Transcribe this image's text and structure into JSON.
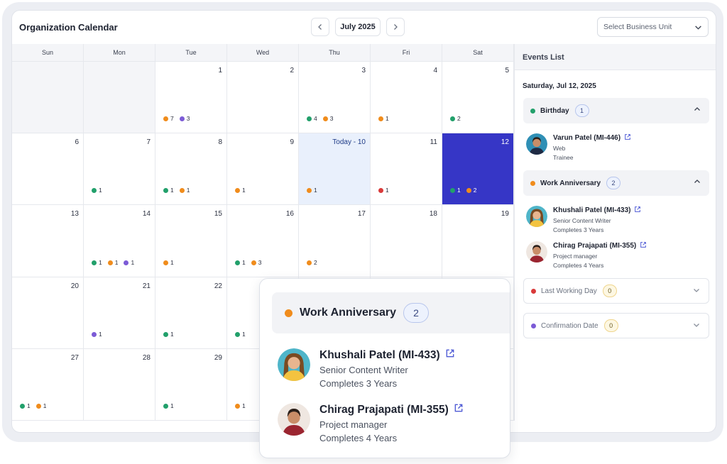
{
  "header": {
    "title": "Organization Calendar",
    "month": "July 2025",
    "prev_icon": "chevron-left-icon",
    "next_icon": "chevron-right-icon",
    "business_unit_placeholder": "Select Business Unit"
  },
  "colors": {
    "green": "#22a06b",
    "orange": "#f08c1c",
    "purple": "#7c5bd6",
    "red": "#d93a3a",
    "selected": "#3636c6",
    "today": "#e9f0fc"
  },
  "weekdays": [
    "Sun",
    "Mon",
    "Tue",
    "Wed",
    "Thu",
    "Fri",
    "Sat"
  ],
  "calendar": {
    "weeks": [
      [
        {
          "day": "",
          "events": []
        },
        {
          "day": "",
          "events": []
        },
        {
          "day": "1",
          "events": [
            {
              "color": "orange",
              "count": "7"
            },
            {
              "color": "purple",
              "count": "3"
            }
          ]
        },
        {
          "day": "2",
          "events": []
        },
        {
          "day": "3",
          "events": [
            {
              "color": "green",
              "count": "4"
            },
            {
              "color": "orange",
              "count": "3"
            }
          ]
        },
        {
          "day": "4",
          "events": [
            {
              "color": "orange",
              "count": "1"
            }
          ]
        },
        {
          "day": "5",
          "events": [
            {
              "color": "green",
              "count": "2"
            }
          ]
        }
      ],
      [
        {
          "day": "6",
          "events": []
        },
        {
          "day": "7",
          "events": [
            {
              "color": "green",
              "count": "1"
            }
          ]
        },
        {
          "day": "8",
          "events": [
            {
              "color": "green",
              "count": "1"
            },
            {
              "color": "orange",
              "count": "1"
            }
          ]
        },
        {
          "day": "9",
          "events": [
            {
              "color": "orange",
              "count": "1"
            }
          ]
        },
        {
          "day": "Today - 10",
          "today": true,
          "events": [
            {
              "color": "orange",
              "count": "1"
            }
          ]
        },
        {
          "day": "11",
          "events": [
            {
              "color": "red",
              "count": "1"
            }
          ]
        },
        {
          "day": "12",
          "selected": true,
          "events": [
            {
              "color": "green",
              "count": "1"
            },
            {
              "color": "orange",
              "count": "2"
            }
          ]
        }
      ],
      [
        {
          "day": "13",
          "events": []
        },
        {
          "day": "14",
          "events": [
            {
              "color": "green",
              "count": "1"
            },
            {
              "color": "orange",
              "count": "1"
            },
            {
              "color": "purple",
              "count": "1"
            }
          ]
        },
        {
          "day": "15",
          "events": [
            {
              "color": "orange",
              "count": "1"
            }
          ]
        },
        {
          "day": "16",
          "events": [
            {
              "color": "green",
              "count": "1"
            },
            {
              "color": "orange",
              "count": "3"
            }
          ]
        },
        {
          "day": "17",
          "events": [
            {
              "color": "orange",
              "count": "2"
            }
          ]
        },
        {
          "day": "18",
          "events": []
        },
        {
          "day": "19",
          "events": []
        }
      ],
      [
        {
          "day": "20",
          "events": []
        },
        {
          "day": "21",
          "events": [
            {
              "color": "purple",
              "count": "1"
            }
          ]
        },
        {
          "day": "22",
          "events": [
            {
              "color": "green",
              "count": "1"
            }
          ]
        },
        {
          "day": "",
          "events": [
            {
              "color": "green",
              "count": "1"
            }
          ]
        },
        {
          "day": "",
          "events": []
        },
        {
          "day": "",
          "events": []
        },
        {
          "day": "",
          "events": []
        }
      ],
      [
        {
          "day": "27",
          "events": [
            {
              "color": "green",
              "count": "1"
            },
            {
              "color": "orange",
              "count": "1"
            }
          ]
        },
        {
          "day": "28",
          "events": []
        },
        {
          "day": "29",
          "events": [
            {
              "color": "green",
              "count": "1"
            }
          ]
        },
        {
          "day": "",
          "events": [
            {
              "color": "orange",
              "count": "1"
            }
          ]
        },
        {
          "day": "",
          "events": []
        },
        {
          "day": "",
          "events": []
        },
        {
          "day": "",
          "events": []
        }
      ]
    ]
  },
  "events_list": {
    "title": "Events List",
    "date": "Saturday, Jul 12, 2025",
    "groups": [
      {
        "name": "Birthday",
        "color": "green",
        "count": "1",
        "expanded": true,
        "people": [
          {
            "name": "Varun Patel (MI-446)",
            "line1": "Web",
            "line2": "Trainee",
            "avatar": "male"
          }
        ]
      },
      {
        "name": "Work Anniversary",
        "color": "orange",
        "count": "2",
        "expanded": true,
        "people": [
          {
            "name": "Khushali Patel (MI-433)",
            "line1": "Senior Content Writer",
            "line2": "Completes 3 Years",
            "avatar": "female"
          },
          {
            "name": "Chirag Prajapati (MI-355)",
            "line1": "Project manager",
            "line2": "Completes 4 Years",
            "avatar": "male2"
          }
        ]
      },
      {
        "name": "Last Working Day",
        "color": "red",
        "count": "0",
        "expanded": false,
        "people": []
      },
      {
        "name": "Confirmation Date",
        "color": "purple",
        "count": "0",
        "expanded": false,
        "people": []
      }
    ]
  },
  "popup": {
    "title": "Work Anniversary",
    "color": "orange",
    "count": "2",
    "people": [
      {
        "name": "Khushali Patel (MI-433)",
        "line1": "Senior Content Writer",
        "line2": "Completes 3 Years",
        "avatar": "female"
      },
      {
        "name": "Chirag Prajapati (MI-355)",
        "line1": "Project manager",
        "line2": "Completes 4 Years",
        "avatar": "male2"
      }
    ]
  }
}
